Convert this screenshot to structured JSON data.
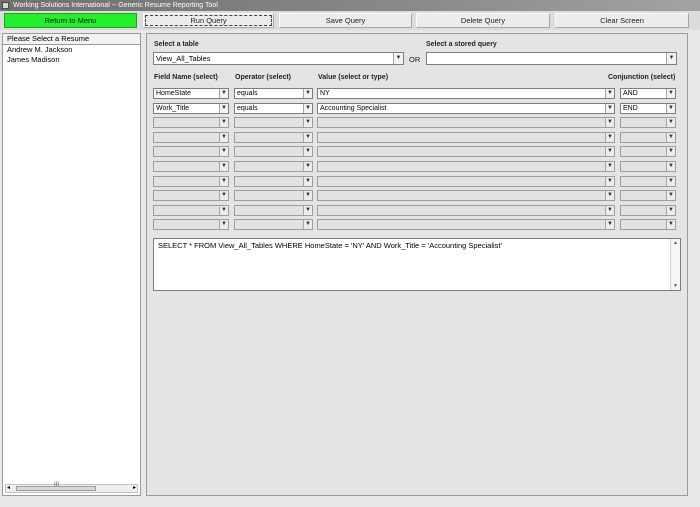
{
  "window": {
    "title": "Working Solutions International  --  Generic Resume Reporting Tool"
  },
  "toolbar": {
    "return": "Return to Menu",
    "run": "Run Query",
    "save": "Save Query",
    "delete": "Delete Query",
    "clear": "Clear Screen"
  },
  "resumes": {
    "header": "Please Select a Resume",
    "items": [
      "Andrew M. Jackson",
      "James Madison"
    ],
    "scroll_grip": "III"
  },
  "query": {
    "select_table_label": "Select a table",
    "table_value": "View_All_Tables",
    "or_label": "OR",
    "stored_query_label": "Select a stored query",
    "stored_query_value": "",
    "columns": {
      "field": "Field Name (select)",
      "operator": "Operator (select)",
      "value": "Value (select or type)",
      "conjunction": "Conjunction (select)"
    },
    "rows": [
      {
        "field": "HomeState",
        "operator": "equals",
        "value": "NY",
        "conjunction": "AND"
      },
      {
        "field": "Work_Title",
        "operator": "equals",
        "value": "Accounting Specialist",
        "conjunction": "END"
      },
      {
        "field": "",
        "operator": "",
        "value": "",
        "conjunction": ""
      },
      {
        "field": "",
        "operator": "",
        "value": "",
        "conjunction": ""
      },
      {
        "field": "",
        "operator": "",
        "value": "",
        "conjunction": ""
      },
      {
        "field": "",
        "operator": "",
        "value": "",
        "conjunction": ""
      },
      {
        "field": "",
        "operator": "",
        "value": "",
        "conjunction": ""
      },
      {
        "field": "",
        "operator": "",
        "value": "",
        "conjunction": ""
      },
      {
        "field": "",
        "operator": "",
        "value": "",
        "conjunction": ""
      },
      {
        "field": "",
        "operator": "",
        "value": "",
        "conjunction": ""
      }
    ],
    "sql": "SELECT * FROM View_All_Tables WHERE  HomeState = 'NY' AND Work_Title = 'Accounting Specialist'"
  },
  "icons": {
    "dropdown": "chevron-down-icon",
    "app": "app-window-icon"
  },
  "colors": {
    "return_button": "#23ef2a",
    "title_bar": "#7d7d7d"
  }
}
